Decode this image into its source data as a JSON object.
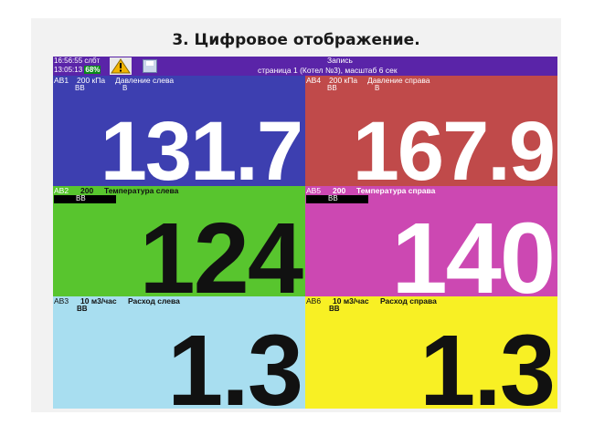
{
  "heading": "3. Цифровое отображение.",
  "status": {
    "time1": "16:56:55",
    "mode": "слбт",
    "time2": "13:05:13",
    "percent": "68%",
    "warning_icon": "warning-triangle-icon",
    "save_icon": "floppy-disk-icon"
  },
  "header": {
    "title": "Запись",
    "page_info": "страница 1 (Котел №3), масштаб 6 сек"
  },
  "panels": [
    {
      "id": "АВ1",
      "unit": "200 кПа",
      "name": "Давление слева",
      "limit_left": "ВВ",
      "limit_right": "В",
      "value": "131.7",
      "bg": "#3d3fb0"
    },
    {
      "id": "АВ4",
      "unit": "200 кПа",
      "name": "Давление справа",
      "limit_left": "ВВ",
      "limit_right": "В",
      "value": "167.9",
      "bg": "#c04a4a"
    },
    {
      "id": "АВ2",
      "unit": "200",
      "name": "Температура слева",
      "limit_left": "ВВ",
      "value": "124",
      "bg": "#58c52e"
    },
    {
      "id": "АВ5",
      "unit": "200",
      "name": "Температура справа",
      "limit_left": "ВВ",
      "value": "140",
      "bg": "#cc48b2"
    },
    {
      "id": "АВ3",
      "unit": "10 м3/час",
      "name": "Расход слева",
      "limit_left": "ВВ",
      "value": "1.3",
      "bg": "#a8def0"
    },
    {
      "id": "АВ6",
      "unit": "10 м3/час",
      "name": "Расход справа",
      "limit_left": "ВВ",
      "value": "1.3",
      "bg": "#f8f024"
    }
  ]
}
